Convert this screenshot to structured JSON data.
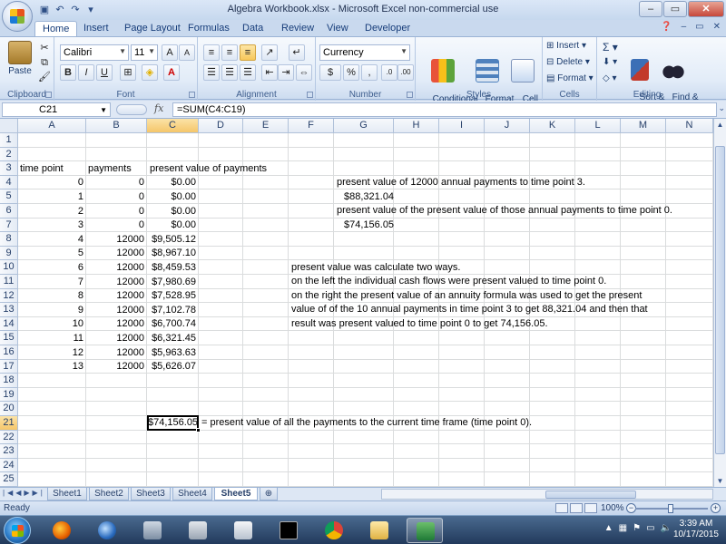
{
  "window": {
    "title": "Algebra Workbook.xlsx - Microsoft Excel non-commercial use"
  },
  "tabs": [
    "Home",
    "Insert",
    "Page Layout",
    "Formulas",
    "Data",
    "Review",
    "View",
    "Developer"
  ],
  "ribbon": {
    "clipboard": {
      "label": "Clipboard",
      "paste": "Paste"
    },
    "font": {
      "label": "Font",
      "name": "Calibri",
      "size": "11",
      "bold": "B",
      "italic": "I",
      "underline": "U"
    },
    "alignment": {
      "label": "Alignment"
    },
    "number": {
      "label": "Number",
      "format": "Currency",
      "currency": "$",
      "percent": "%",
      "comma": ","
    },
    "styles": {
      "label": "Styles",
      "conditional": "Conditional\nFormatting",
      "table": "Format\nas Table",
      "cell": "Cell\nStyles"
    },
    "cells": {
      "label": "Cells",
      "insert": "Insert",
      "delete": "Delete",
      "format": "Format"
    },
    "editing": {
      "label": "Editing",
      "sort": "Sort &\nFilter",
      "find": "Find &\nSelect"
    }
  },
  "formula_bar": {
    "name_box": "C21",
    "fx": "fx",
    "formula": "=SUM(C4:C19)"
  },
  "columns": [
    "A",
    "B",
    "C",
    "D",
    "E",
    "F",
    "G",
    "H",
    "I",
    "J",
    "K",
    "L",
    "M",
    "N"
  ],
  "rows": [
    "1",
    "2",
    "3",
    "4",
    "5",
    "6",
    "7",
    "8",
    "9",
    "10",
    "11",
    "12",
    "13",
    "14",
    "15",
    "16",
    "17",
    "18",
    "19",
    "20",
    "21",
    "22",
    "23",
    "24",
    "25"
  ],
  "headers": {
    "a3": "time point",
    "b3": "payments",
    "c3": "present value of payments"
  },
  "table": [
    {
      "t": "0",
      "p": "0",
      "pv": "$0.00"
    },
    {
      "t": "1",
      "p": "0",
      "pv": "$0.00"
    },
    {
      "t": "2",
      "p": "0",
      "pv": "$0.00"
    },
    {
      "t": "3",
      "p": "0",
      "pv": "$0.00"
    },
    {
      "t": "4",
      "p": "12000",
      "pv": "$9,505.12"
    },
    {
      "t": "5",
      "p": "12000",
      "pv": "$8,967.10"
    },
    {
      "t": "6",
      "p": "12000",
      "pv": "$8,459.53"
    },
    {
      "t": "7",
      "p": "12000",
      "pv": "$7,980.69"
    },
    {
      "t": "8",
      "p": "12000",
      "pv": "$7,528.95"
    },
    {
      "t": "9",
      "p": "12000",
      "pv": "$7,102.78"
    },
    {
      "t": "10",
      "p": "12000",
      "pv": "$6,700.74"
    },
    {
      "t": "11",
      "p": "12000",
      "pv": "$6,321.45"
    },
    {
      "t": "12",
      "p": "12000",
      "pv": "$5,963.63"
    },
    {
      "t": "13",
      "p": "12000",
      "pv": "$5,626.07"
    }
  ],
  "notes_right": {
    "g4": "present value of 12000 annual payments to time point 3.",
    "g5": "$88,321.04",
    "g6": "present value of the present value of those annual payments to time point 0.",
    "g7": "$74,156.05"
  },
  "explanation": [
    "present value was calculate two ways.",
    "on the left the individual cash flows were present valued to time point 0.",
    "on the right the present value of an annuity formula was used to get the present",
    "value of of the 10 annual payments in time point 3 to get 88,321.04 and then that",
    "result was present valued to time point 0 to get 74,156.05."
  ],
  "total": {
    "value": "$74,156.05",
    "note": "= present value of all the payments to the current time frame (time point 0)."
  },
  "sheets": [
    "Sheet1",
    "Sheet2",
    "Sheet3",
    "Sheet4",
    "Sheet5"
  ],
  "active_sheet": "Sheet5",
  "status": {
    "ready": "Ready",
    "zoom": "100%"
  },
  "taskbar": {
    "time": "3:39 AM",
    "date": "10/17/2015"
  }
}
